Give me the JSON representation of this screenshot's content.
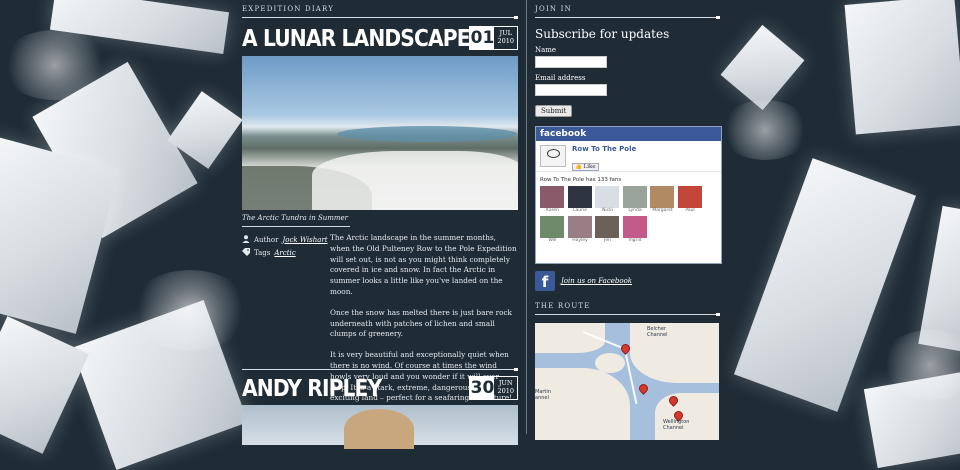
{
  "main": {
    "section_label": "EXPEDITION DIARY",
    "posts": [
      {
        "title": "A LUNAR LANDSCAPE",
        "day": "01",
        "month": "JUL",
        "year": "2010",
        "caption": "The Arctic Tundra in Summer",
        "author_label": "Author",
        "author": "Jock Wishart",
        "tags_label": "Tags",
        "tag": "Arctic",
        "paragraphs": [
          "The Arctic landscape in the summer months, when the Old Pulteney Row to the Pole Expedition will set out, is not as you might think completely covered in ice and snow. In fact the Arctic in summer looks a little like you've landed on the moon.",
          "Once the snow has melted there is just bare rock underneath with patches of lichen and small clumps of greenery.",
          "It is very beautiful and exceptionally quiet when there is no wind. Of course at times the wind howls very loud and you wonder if it will ever stop. It is a stark, extreme, dangerous and exciting land – perfect for a seafaring adventure!"
        ]
      },
      {
        "title": "ANDY RIPLEY",
        "day": "30",
        "month": "JUN",
        "year": "2010"
      }
    ]
  },
  "sidebar": {
    "join_label": "JOIN IN",
    "subscribe_title": "Subscribe for updates",
    "name_label": "Name",
    "email_label": "Email address",
    "submit_label": "Submit",
    "facebook": {
      "header": "facebook",
      "page_name": "Row To The Pole",
      "like_label": "Like",
      "fan_count_text": "Row To The Pole has 133 fans",
      "fans": [
        {
          "name": "Karen",
          "color": "#8a5a6a"
        },
        {
          "name": "Laurie",
          "color": "#2e3342"
        },
        {
          "name": "Nicki",
          "color": "#d9dde4"
        },
        {
          "name": "Lynda",
          "color": "#9aa39a"
        },
        {
          "name": "Margaret",
          "color": "#b08a62"
        },
        {
          "name": "Paul",
          "color": "#c2453a"
        },
        {
          "name": "Will",
          "color": "#6f8a6a"
        },
        {
          "name": "Hayley",
          "color": "#9a7e86"
        },
        {
          "name": "Jen",
          "color": "#6b6158"
        },
        {
          "name": "Ingrid",
          "color": "#c25a8a"
        }
      ],
      "join_text": "Join us on Facebook"
    },
    "route_label": "THE ROUTE",
    "map_labels": [
      "Belcher Channel",
      "Martin annel",
      "Wellington Channel"
    ]
  }
}
